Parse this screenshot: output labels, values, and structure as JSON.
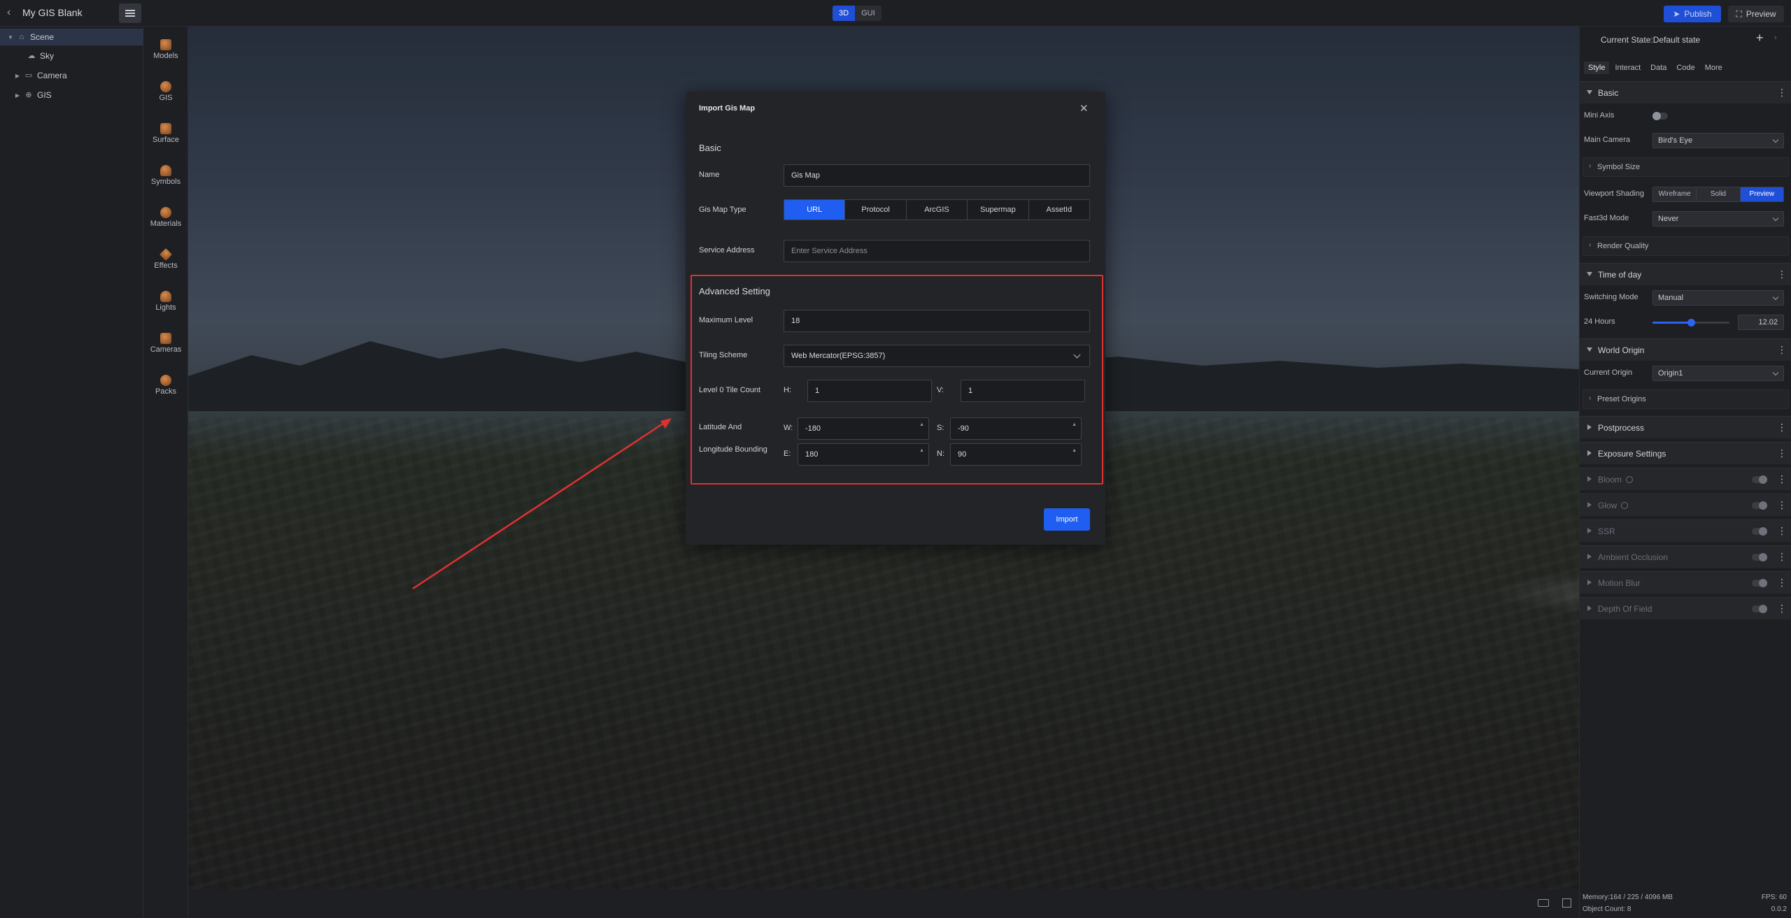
{
  "header": {
    "project_title": "My GIS Blank",
    "mode_3d": "3D",
    "mode_gui": "GUI",
    "publish_label": "Publish",
    "preview_label": "Preview"
  },
  "tree": {
    "items": [
      {
        "label": "Scene",
        "icon": "scene-icon"
      },
      {
        "label": "Sky",
        "icon": "sky-icon"
      },
      {
        "label": "Camera",
        "icon": "folder-icon"
      },
      {
        "label": "GIS",
        "icon": "gis-icon"
      }
    ]
  },
  "assets": {
    "items": [
      {
        "label": "Models"
      },
      {
        "label": "GIS"
      },
      {
        "label": "Surface"
      },
      {
        "label": "Symbols"
      },
      {
        "label": "Materials"
      },
      {
        "label": "Effects"
      },
      {
        "label": "Lights"
      },
      {
        "label": "Cameras"
      },
      {
        "label": "Packs"
      }
    ]
  },
  "right_panel": {
    "state_label": "Current State:Default state",
    "tabs": [
      "Style",
      "Interact",
      "Data",
      "Code",
      "More"
    ],
    "basic": {
      "title": "Basic",
      "mini_axis_label": "Mini Axis",
      "main_camera_label": "Main Camera",
      "main_camera_value": "Bird's Eye",
      "symbol_size_label": "Symbol Size",
      "viewport_shading_label": "Viewport Shading",
      "shading_options": [
        "Wireframe",
        "Solid",
        "Preview"
      ],
      "shading_selected": "Preview",
      "fast3d_label": "Fast3d Mode",
      "fast3d_value": "Never",
      "render_quality_label": "Render Quality"
    },
    "time_of_day": {
      "title": "Time of day",
      "switching_label": "Switching Mode",
      "switching_value": "Manual",
      "hours_label": "24 Hours",
      "hours_value": "12.02",
      "hours_fraction": 0.5
    },
    "world_origin": {
      "title": "World Origin",
      "current_label": "Current Origin",
      "current_value": "Origin1",
      "preset_label": "Preset Origins"
    },
    "postprocess_title": "Postprocess",
    "exposure_title": "Exposure Settings",
    "effects": [
      "Bloom",
      "Glow",
      "SSR",
      "Ambient Occlusion",
      "Motion Blur",
      "Depth Of Field"
    ],
    "footer": {
      "memory": "Memory:164 / 225 / 4096 MB",
      "object_count": "Object Count: 8",
      "fps": "FPS: 60",
      "version": "0.0.2"
    }
  },
  "modal": {
    "title": "Import Gis Map",
    "basic_heading": "Basic",
    "name_label": "Name",
    "name_value": "Gis Map",
    "type_label": "Gis Map Type",
    "type_options": [
      "URL",
      "Protocol",
      "ArcGIS",
      "Supermap",
      "AssetId"
    ],
    "type_selected": "URL",
    "service_label": "Service Address",
    "service_placeholder": "Enter Service Address",
    "advanced_heading": "Advanced Setting",
    "max_level_label": "Maximum Level",
    "max_level_value": "18",
    "tiling_label": "Tiling Scheme",
    "tiling_value": "Web Mercator(EPSG:3857)",
    "tile_count_label": "Level 0 Tile Count",
    "h_label": "H:",
    "h_value": "1",
    "v_label": "V:",
    "v_value": "1",
    "bounding_label_1": "Latitude And",
    "bounding_label_2": "Longitude Bounding",
    "w_label": "W:",
    "w_value": "-180",
    "s_label": "S:",
    "s_value": "-90",
    "e_label": "E:",
    "e_value": "180",
    "n_label": "N:",
    "n_value": "90",
    "import_label": "Import"
  },
  "colors": {
    "accent": "#1f5ef0",
    "highlight_box": "#e03131"
  }
}
